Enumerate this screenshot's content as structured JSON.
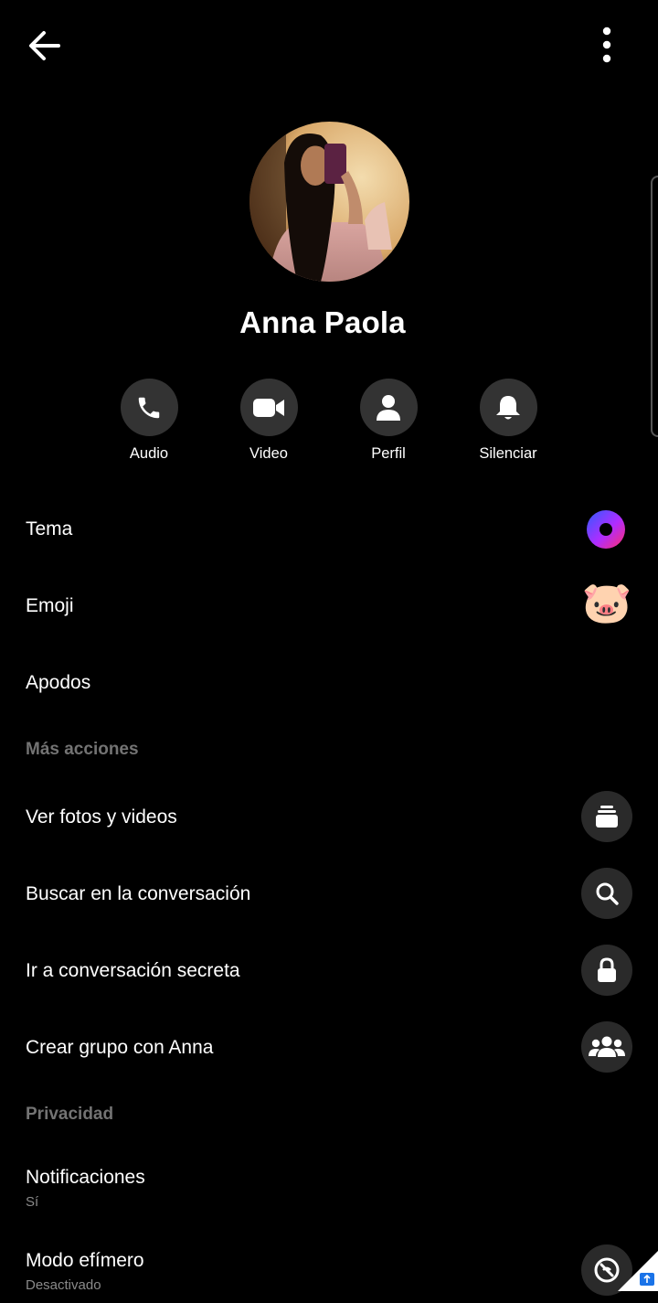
{
  "header": {
    "back_icon": "arrow-left-icon",
    "more_icon": "more-vertical-icon"
  },
  "profile": {
    "name": "Anna Paola",
    "avatar": "profile-photo"
  },
  "actions": [
    {
      "label": "Audio",
      "icon": "phone-icon"
    },
    {
      "label": "Video",
      "icon": "video-camera-icon"
    },
    {
      "label": "Perfil",
      "icon": "person-icon"
    },
    {
      "label": "Silenciar",
      "icon": "bell-icon"
    }
  ],
  "customize": {
    "theme_label": "Tema",
    "emoji_label": "Emoji",
    "emoji_value": "🐷",
    "nicknames_label": "Apodos"
  },
  "more_actions": {
    "header": "Más acciones",
    "items": [
      {
        "label": "Ver fotos y videos",
        "icon": "photos-stack-icon"
      },
      {
        "label": "Buscar en la conversación",
        "icon": "search-icon"
      },
      {
        "label": "Ir a conversación secreta",
        "icon": "lock-icon"
      },
      {
        "label": "Crear grupo con Anna",
        "icon": "group-icon"
      }
    ]
  },
  "privacy": {
    "header": "Privacidad",
    "notifications_label": "Notificaciones",
    "notifications_value": "Sí",
    "vanish_label": "Modo efímero",
    "vanish_value": "Desactivado",
    "vanish_icon": "vanish-mode-icon"
  },
  "colors": {
    "background": "#000000",
    "circle_button": "#333333",
    "row_icon_bg": "#2a2a2a",
    "section_header": "#737373",
    "theme_gradient_start": "#2f5bff",
    "theme_gradient_end": "#ff2e6d"
  }
}
